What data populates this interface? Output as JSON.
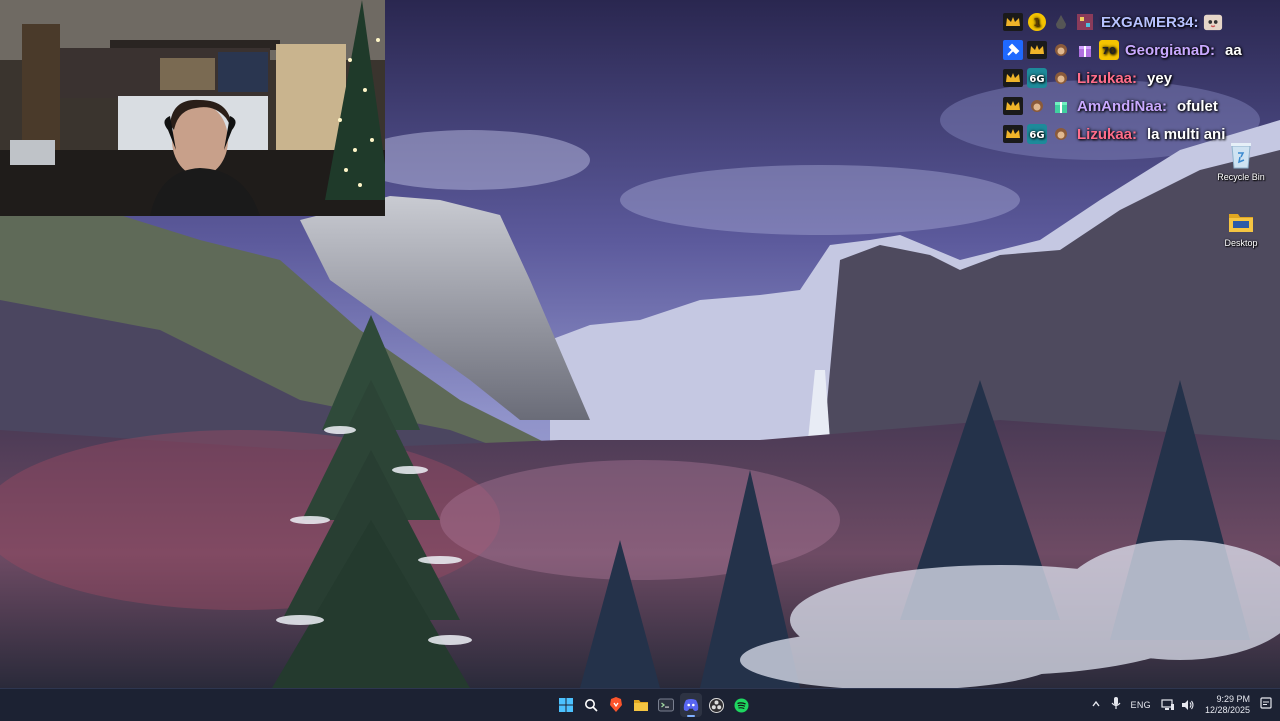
{
  "chat": {
    "messages": [
      {
        "user": "EXGAMER34:",
        "message": "",
        "color": "#b7c2ff",
        "badges": [
          "crown-badge-icon",
          "one-badge-icon",
          "drop-badge-icon",
          "pixel-badge-icon"
        ],
        "emote": "cat-emote-icon"
      },
      {
        "user": "GeorgianaD:",
        "message": "aa",
        "color": "#c9a9ff",
        "badges": [
          "hammer-badge-icon",
          "crown-badge-icon",
          "monkey-badge-icon",
          "gift-badge-icon",
          "seventy-badge-icon"
        ]
      },
      {
        "user": "Lizukaa:",
        "message": "yey",
        "color": "#ff6d8a",
        "badges": [
          "crown-badge-icon",
          "sixty-badge-icon",
          "monkey-badge-icon"
        ]
      },
      {
        "user": "AmAndiNaa:",
        "message": "ofulet",
        "color": "#c9a9ff",
        "badges": [
          "crown-badge-icon",
          "monkey-badge-icon",
          "gift-badge-icon"
        ]
      },
      {
        "user": "Lizukaa:",
        "message": "la multi ani",
        "color": "#ff6d8a",
        "badges": [
          "crown-badge-icon",
          "sixty-badge-icon",
          "monkey-badge-icon"
        ]
      }
    ]
  },
  "desktop": {
    "icons": [
      {
        "label": "Recycle Bin",
        "icon": "recycle-bin-icon"
      },
      {
        "label": "Desktop",
        "icon": "folder-icon"
      }
    ]
  },
  "taskbar": {
    "apps": [
      "windows-start-icon",
      "search-icon",
      "brave-icon",
      "file-explorer-icon",
      "terminal-icon",
      "discord-icon",
      "obs-icon",
      "spotify-icon"
    ],
    "language": "ENG",
    "time": "9:29 PM",
    "date": "12/28/2025"
  },
  "colors": {
    "taskbar": "#1c2233",
    "sky": "#5a5a9a",
    "crown": "#f0b429"
  }
}
